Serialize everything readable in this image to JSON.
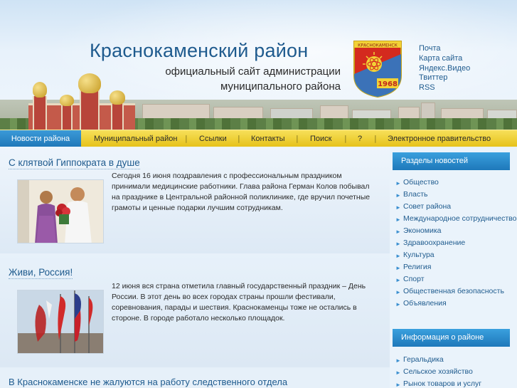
{
  "header": {
    "title": "Краснокаменский район",
    "subtitle_line1": "официальный сайт администрации",
    "subtitle_line2": "муниципального района",
    "coat_of_arms": {
      "top_text": "КРАСНОКАМЕНСК",
      "year": "1968"
    },
    "links": [
      "Почта",
      "Карта сайта",
      "Яндекс.Видео",
      "Твиттер",
      "RSS"
    ]
  },
  "nav": {
    "items": [
      "Новости района",
      "Муниципальный район",
      "Ссылки",
      "Контакты",
      "Поиск",
      "?",
      "Электронное правительство"
    ],
    "separator": "|",
    "active_index": 0
  },
  "articles": [
    {
      "title": "С клятвой Гиппократа в душе",
      "text": "Сегодня 16 июня поздравления с профессиональным праздником принимали медицинские работники. Глава района Герман Колов побывал на празднике в Центральной районной поликлинике, где вручил почетные грамоты и ценные подарки лучшим сотрудникам."
    },
    {
      "title": "Живи, Россия!",
      "text": "12 июня вся страна отметила главный государственный праздник – День России. В этот день во всех городах страны прошли фестивали, соревнования, парады и шествия. Краснокаменцы тоже не остались в стороне. В городе работало несколько площадок."
    },
    {
      "title": "В Краснокаменске не жалуются на работу следственного отдела"
    }
  ],
  "sidebar": {
    "news_sections_title": "Разделы новостей",
    "news_sections": [
      "Общество",
      "Власть",
      "Совет района",
      "Международное сотрудничество",
      "Экономика",
      "Здравоохранение",
      "Культура",
      "Религия",
      "Спорт",
      "Общественная безопасность",
      "Объявления"
    ],
    "info_title": "Информация о районе",
    "info_items": [
      "Геральдика",
      "Сельское хозяйство",
      "Рынок товаров и услуг"
    ]
  },
  "colors": {
    "accent": "#1f5b8e",
    "nav_yellow": "#f2d236",
    "nav_active": "#2a88c8",
    "sidebar_header": "#2c8fd0"
  }
}
